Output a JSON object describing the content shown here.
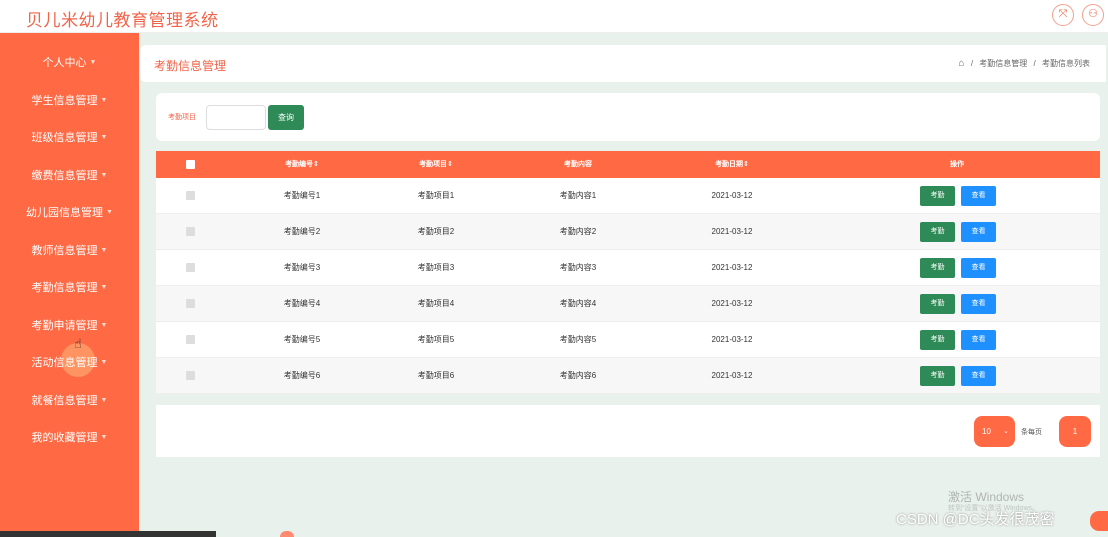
{
  "header": {
    "title": "贝儿米幼儿教育管理系统",
    "icons": [
      "fullscreen-icon",
      "user-icon"
    ]
  },
  "sidebar": {
    "items": [
      {
        "label": "个人中心"
      },
      {
        "label": "学生信息管理"
      },
      {
        "label": "班级信息管理"
      },
      {
        "label": "缴费信息管理"
      },
      {
        "label": "幼儿园信息管理"
      },
      {
        "label": "教师信息管理"
      },
      {
        "label": "考勤信息管理"
      },
      {
        "label": "考勤申请管理"
      },
      {
        "label": "活动信息管理"
      },
      {
        "label": "就餐信息管理"
      },
      {
        "label": "我的收藏管理"
      }
    ]
  },
  "page": {
    "title": "考勤信息管理",
    "breadcrumb": [
      "考勤信息管理",
      "考勤信息列表"
    ]
  },
  "search": {
    "label": "考勤项目",
    "value": "",
    "button": "查询"
  },
  "table": {
    "headers": [
      "考勤编号",
      "考勤项目",
      "考勤内容",
      "考勤日期",
      "操作"
    ],
    "rows": [
      {
        "id": "考勤编号1",
        "item": "考勤项目1",
        "content": "考勤内容1",
        "date": "2021-03-12"
      },
      {
        "id": "考勤编号2",
        "item": "考勤项目2",
        "content": "考勤内容2",
        "date": "2021-03-12"
      },
      {
        "id": "考勤编号3",
        "item": "考勤项目3",
        "content": "考勤内容3",
        "date": "2021-03-12"
      },
      {
        "id": "考勤编号4",
        "item": "考勤项目4",
        "content": "考勤内容4",
        "date": "2021-03-12"
      },
      {
        "id": "考勤编号5",
        "item": "考勤项目5",
        "content": "考勤内容5",
        "date": "2021-03-12"
      },
      {
        "id": "考勤编号6",
        "item": "考勤项目6",
        "content": "考勤内容6",
        "date": "2021-03-12"
      }
    ],
    "action_attend": "考勤",
    "action_view": "查看"
  },
  "pagination": {
    "page_size": "10",
    "per_page_label": "条每页",
    "current_page": "1"
  },
  "watermarks": {
    "windows_line1": "激活 Windows",
    "windows_line2": "转到“设置”以激活 Windows。",
    "csdn": "CSDN @DC头发很茂密"
  },
  "colors": {
    "accent": "#ff6a45",
    "title": "#f0654a",
    "green_button": "#2e8b57",
    "blue_button": "#1e90ff",
    "background": "#e9f1ec"
  }
}
